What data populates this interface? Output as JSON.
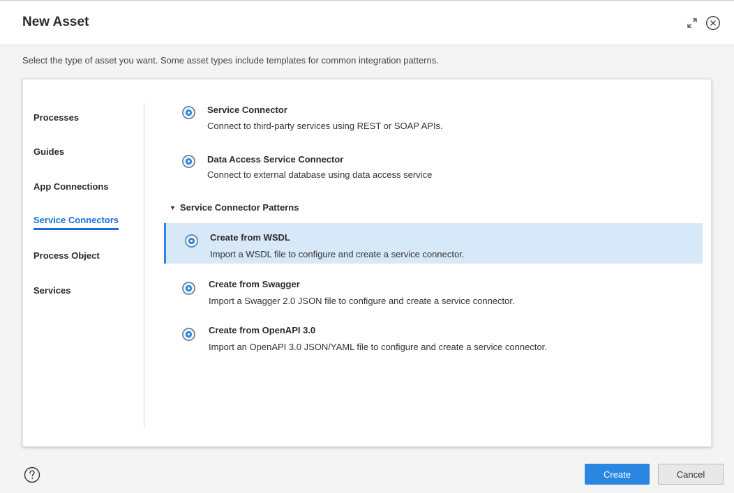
{
  "dialog": {
    "title": "New Asset",
    "subtitle": "Select the type of asset you want. Some asset types include templates for common integration patterns.",
    "expand_icon": "expand-icon",
    "close_icon": "close-circle-icon"
  },
  "sidebar": {
    "items": [
      {
        "label": "Processes"
      },
      {
        "label": "Guides"
      },
      {
        "label": "App Connections"
      },
      {
        "label": "Service Connectors",
        "active": true
      },
      {
        "label": "Process Object"
      },
      {
        "label": "Services"
      }
    ]
  },
  "assets": {
    "items": [
      {
        "title": "Service Connector",
        "desc": "Connect to third-party services using REST or SOAP APIs."
      },
      {
        "title": "Data Access Service Connector",
        "desc": "Connect to external database using data access service"
      }
    ],
    "patterns_heading": "Service Connector Patterns",
    "patterns": [
      {
        "title": "Create from WSDL",
        "desc": "Import a WSDL file to configure and create a service connector.",
        "selected": true
      },
      {
        "title": "Create from Swagger",
        "desc": "Import a Swagger 2.0 JSON file to configure and create a service connector."
      },
      {
        "title": "Create from OpenAPI 3.0",
        "desc": "Import an OpenAPI 3.0 JSON/YAML file to configure and create a service connector."
      }
    ],
    "item_icon": "gear-icon"
  },
  "footer": {
    "help_icon": "help-icon",
    "create_label": "Create",
    "cancel_label": "Cancel"
  },
  "colors": {
    "accent": "#2a86e0",
    "selected_bg": "#d7e8f8",
    "active_nav": "#1a6fd6"
  }
}
